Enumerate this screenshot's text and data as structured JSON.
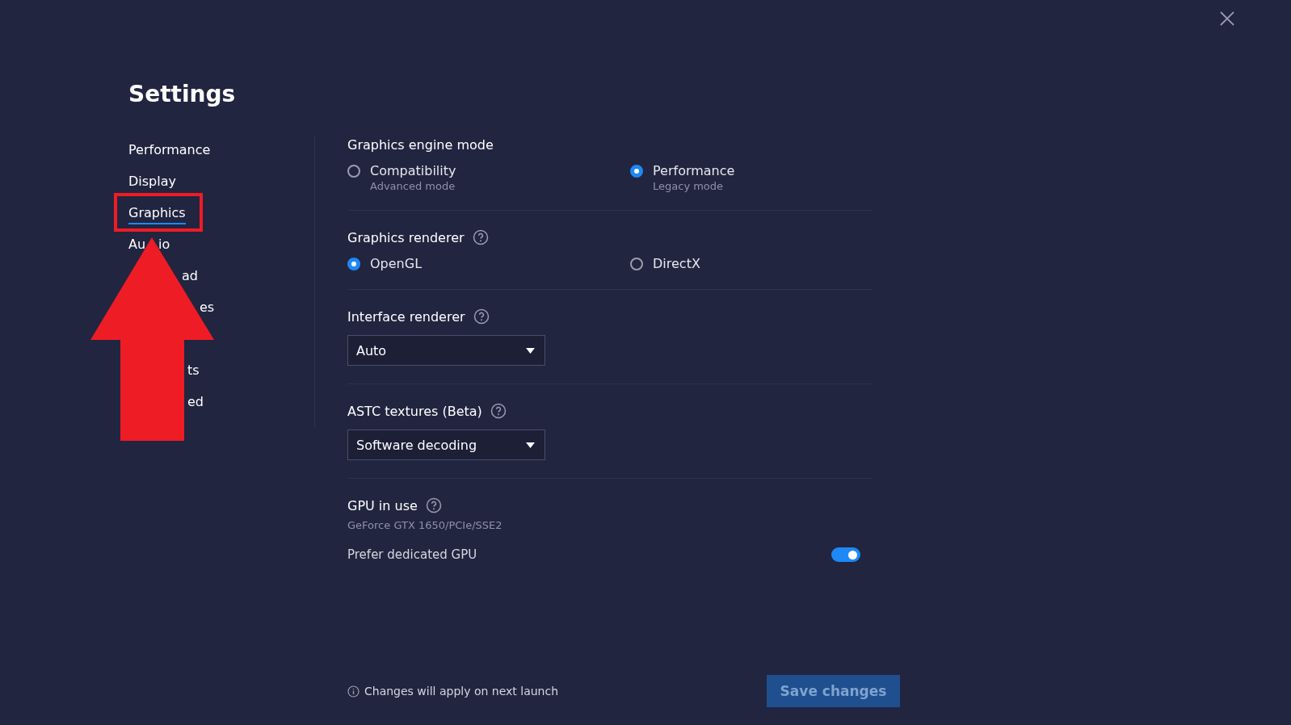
{
  "title": "Settings",
  "sidebar": {
    "items": [
      {
        "parts": [
          "Performance"
        ],
        "selected": false
      },
      {
        "parts": [
          "Display"
        ],
        "selected": false
      },
      {
        "parts": [
          "Graphics"
        ],
        "selected": true
      },
      {
        "parts": [
          "Au",
          "io"
        ],
        "selected": false
      },
      {
        "parts": [
          "ad"
        ],
        "selected": false
      },
      {
        "parts": [
          "es"
        ],
        "selected": false
      },
      {
        "parts": [
          "ts"
        ],
        "selected": false
      },
      {
        "parts": [
          "ed"
        ],
        "selected": false
      }
    ]
  },
  "sections": [
    {
      "kind": "radio",
      "title": "Graphics engine mode",
      "help": false,
      "options": [
        {
          "label": "Compatibility",
          "sublabel": "Advanced mode",
          "selected": false
        },
        {
          "label": "Performance",
          "sublabel": "Legacy mode",
          "selected": true
        }
      ]
    },
    {
      "kind": "radio",
      "title": "Graphics renderer",
      "help": true,
      "options": [
        {
          "label": "OpenGL",
          "selected": true
        },
        {
          "label": "DirectX",
          "selected": false
        }
      ]
    },
    {
      "kind": "select",
      "title": "Interface renderer",
      "help": true,
      "value": "Auto"
    },
    {
      "kind": "select",
      "title": "ASTC textures (Beta)",
      "help": true,
      "value": "Software decoding"
    },
    {
      "kind": "gpu",
      "title": "GPU in use",
      "help": true,
      "detail": "GeForce GTX 1650/PCIe/SSE2",
      "toggle": {
        "label": "Prefer dedicated GPU",
        "on": true
      }
    }
  ],
  "footer": {
    "note": "Changes will apply on next launch",
    "save_button": {
      "label": "Save changes",
      "disabled": true
    }
  },
  "annotations": {
    "highlight_box": true,
    "arrow": true
  }
}
